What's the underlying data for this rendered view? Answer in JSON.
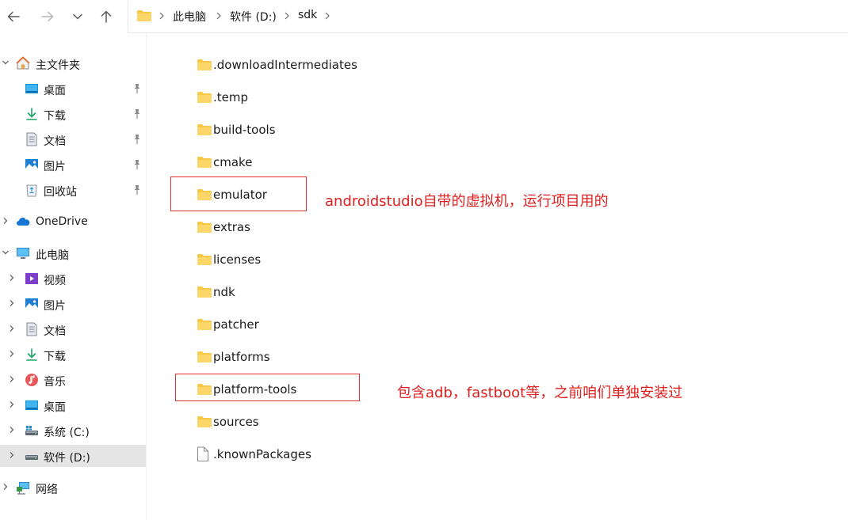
{
  "toolbar": {
    "back_icon": "arrow-left-icon",
    "forward_icon": "arrow-right-icon",
    "recent_icon": "chevron-down-icon",
    "up_icon": "arrow-up-icon"
  },
  "breadcrumb": [
    "此电脑",
    "软件 (D:)",
    "sdk"
  ],
  "sidebar": {
    "home": "主文件夹",
    "quick": [
      {
        "label": "桌面",
        "icon": "desktop-icon"
      },
      {
        "label": "下载",
        "icon": "download-icon"
      },
      {
        "label": "文档",
        "icon": "document-icon"
      },
      {
        "label": "图片",
        "icon": "pictures-icon"
      },
      {
        "label": "回收站",
        "icon": "recycle-bin-icon"
      }
    ],
    "onedrive": "OneDrive",
    "thispc": "此电脑",
    "pc_items": [
      {
        "label": "视频",
        "icon": "video-icon"
      },
      {
        "label": "图片",
        "icon": "pictures-icon"
      },
      {
        "label": "文档",
        "icon": "document-icon"
      },
      {
        "label": "下载",
        "icon": "download-icon"
      },
      {
        "label": "音乐",
        "icon": "music-icon"
      },
      {
        "label": "桌面",
        "icon": "desktop-icon"
      },
      {
        "label": "系统 (C:)",
        "icon": "drive-icon"
      },
      {
        "label": "软件 (D:)",
        "icon": "drive-icon"
      }
    ],
    "selected": "软件 (D:)",
    "network": "网络"
  },
  "files": [
    {
      "name": ".downloadIntermediates",
      "type": "folder"
    },
    {
      "name": ".temp",
      "type": "folder"
    },
    {
      "name": "build-tools",
      "type": "folder"
    },
    {
      "name": "cmake",
      "type": "folder"
    },
    {
      "name": "emulator",
      "type": "folder"
    },
    {
      "name": "extras",
      "type": "folder"
    },
    {
      "name": "licenses",
      "type": "folder"
    },
    {
      "name": "ndk",
      "type": "folder"
    },
    {
      "name": "patcher",
      "type": "folder"
    },
    {
      "name": "platforms",
      "type": "folder"
    },
    {
      "name": "platform-tools",
      "type": "folder"
    },
    {
      "name": "sources",
      "type": "folder"
    },
    {
      "name": ".knownPackages",
      "type": "file"
    }
  ],
  "annotations": {
    "emulator_note": "androidstudio自带的虚拟机，运行项目用的",
    "platform_tools_note": "包含adb，fastboot等，之前咱们单独安装过",
    "color": "#e02020"
  }
}
